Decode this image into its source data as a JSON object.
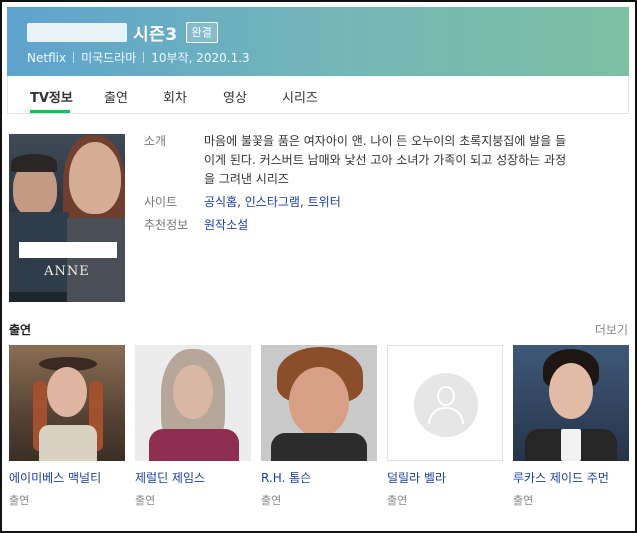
{
  "header": {
    "title": "시즌3",
    "status_badge": "완결",
    "meta": [
      "Netflix",
      "미국드라마",
      "10부작, 2020.1.3"
    ],
    "gradient_colors": [
      "#5fa3cf",
      "#7cc0a4"
    ]
  },
  "tabs": [
    {
      "label": "TV정보",
      "active": true
    },
    {
      "label": "출연",
      "active": false
    },
    {
      "label": "회차",
      "active": false
    },
    {
      "label": "영상",
      "active": false
    },
    {
      "label": "시리즈",
      "active": false
    }
  ],
  "details": {
    "poster_logo": "ANNE",
    "synopsis_label": "소개",
    "synopsis_lines": [
      "마음에 불꽃을 품은 여자아이 앤. 나이 든 오누이의 초록지붕집에 발을 들",
      "이게 된다. 커스버트 남매와 낯선 고아 소녀가 가족이 되고 성장하는 과정",
      "을 그려낸 시리즈"
    ],
    "site_label": "사이트",
    "sites": [
      "공식홈",
      "인스타그램",
      "트위터"
    ],
    "recommend_label": "추천정보",
    "recommend_value": "원작소설"
  },
  "cast": {
    "title": "출연",
    "more_label": "더보기",
    "members": [
      {
        "name": "에이미베스 맥널티",
        "role": "출연"
      },
      {
        "name": "제럴딘 제임스",
        "role": "출연"
      },
      {
        "name": "R.H. 톰슨",
        "role": "출연"
      },
      {
        "name": "덜릴라 벨라",
        "role": "출연"
      },
      {
        "name": "루카스 제이드 주먼",
        "role": "출연"
      }
    ]
  },
  "colors": {
    "accent_green": "#03c75a",
    "link_blue": "#1a3fa4"
  }
}
